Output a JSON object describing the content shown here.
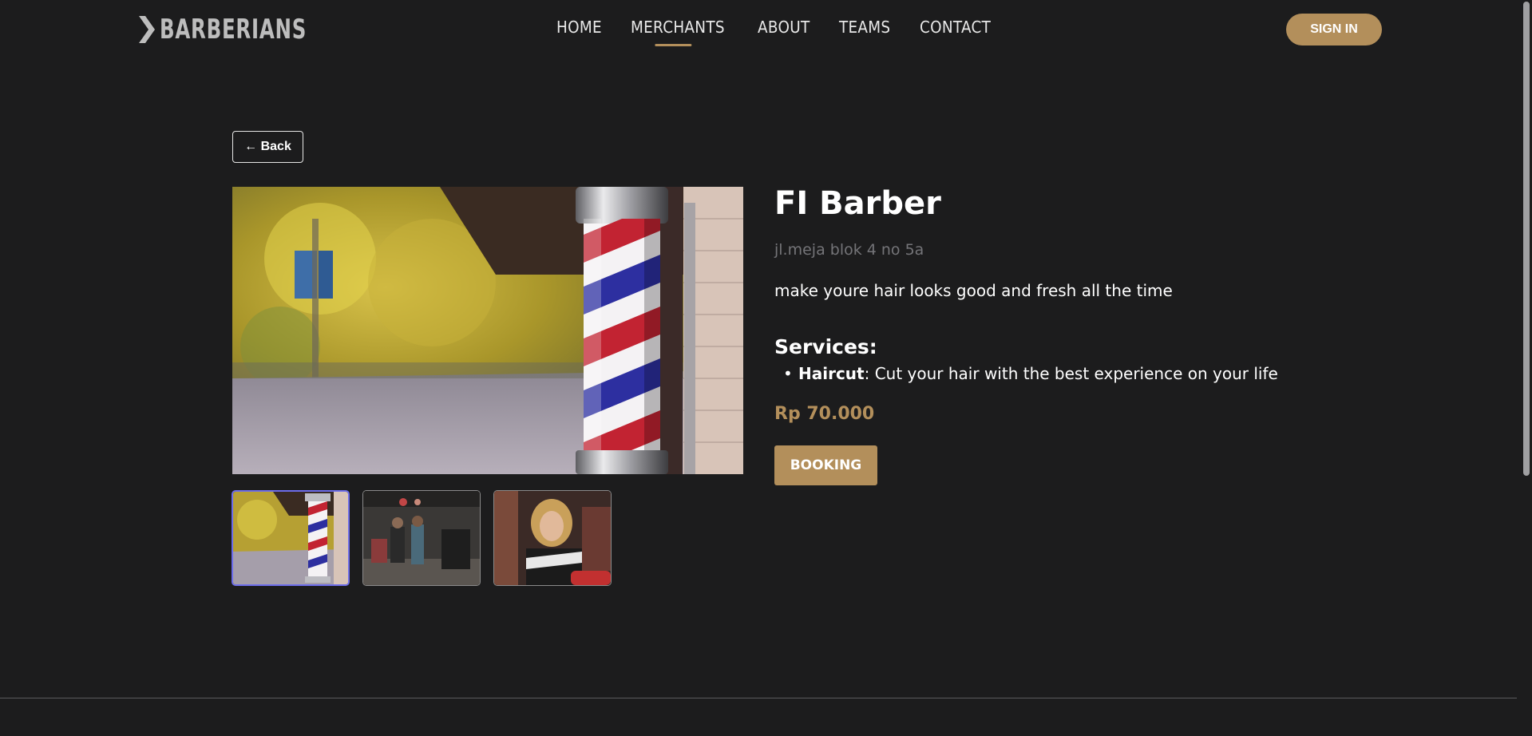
{
  "navbar": {
    "logo_text": "BARBERIANS",
    "links": [
      "HOME",
      "MERCHANTS",
      "ABOUT",
      "TEAMS",
      "CONTACT"
    ],
    "active_link": "MERCHANTS",
    "sign_in_label": "SIGN IN"
  },
  "back_label": "← Back",
  "merchant": {
    "name": "FI Barber",
    "address": "jl.meja blok 4 no 5a",
    "description": "make youre hair looks good and fresh all the time",
    "services_heading": "Services:",
    "services": [
      {
        "name": "Haircut",
        "detail": ": Cut your hair with the best experience on your life"
      }
    ],
    "price": "Rp 70.000",
    "booking_label": "BOOKING"
  },
  "gallery": {
    "images": [
      "barber-pole-photo",
      "barbershop-interior-photo",
      "woman-portrait-photo"
    ],
    "selected_index": 0
  },
  "colors": {
    "background": "#1c1c1d",
    "accent": "#b38f5b",
    "muted_text": "#747478",
    "selected_border": "#6d6dea"
  }
}
